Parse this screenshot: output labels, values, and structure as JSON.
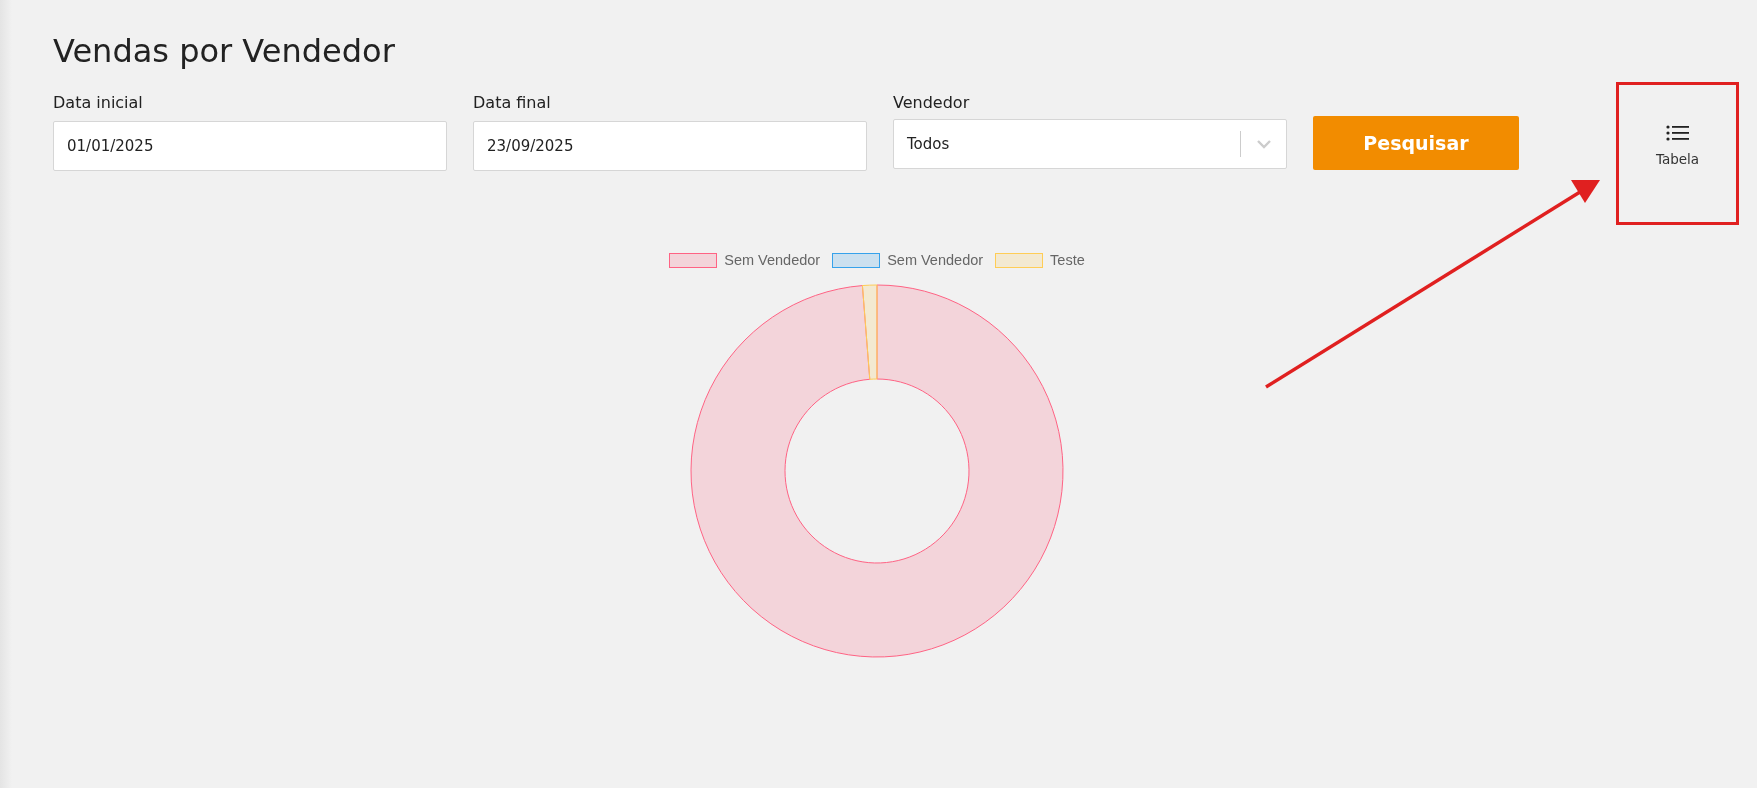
{
  "title": "Vendas por Vendedor",
  "filters": [
    {
      "kind": "input",
      "label": "Data inicial",
      "value": "01/01/2025"
    },
    {
      "kind": "input",
      "label": "Data final",
      "value": "23/09/2025"
    },
    {
      "kind": "select",
      "label": "Vendedor",
      "value": "Todos"
    }
  ],
  "search_button": "Pesquisar",
  "view_toggle": {
    "label": "Tabela"
  },
  "chart": {
    "legend": [
      {
        "label": "Sem Vendedor",
        "color": "#ff6384"
      },
      {
        "label": "Sem Vendedor",
        "color": "#36a2eb"
      },
      {
        "label": "Teste",
        "color": "#ffcd56"
      }
    ]
  }
}
